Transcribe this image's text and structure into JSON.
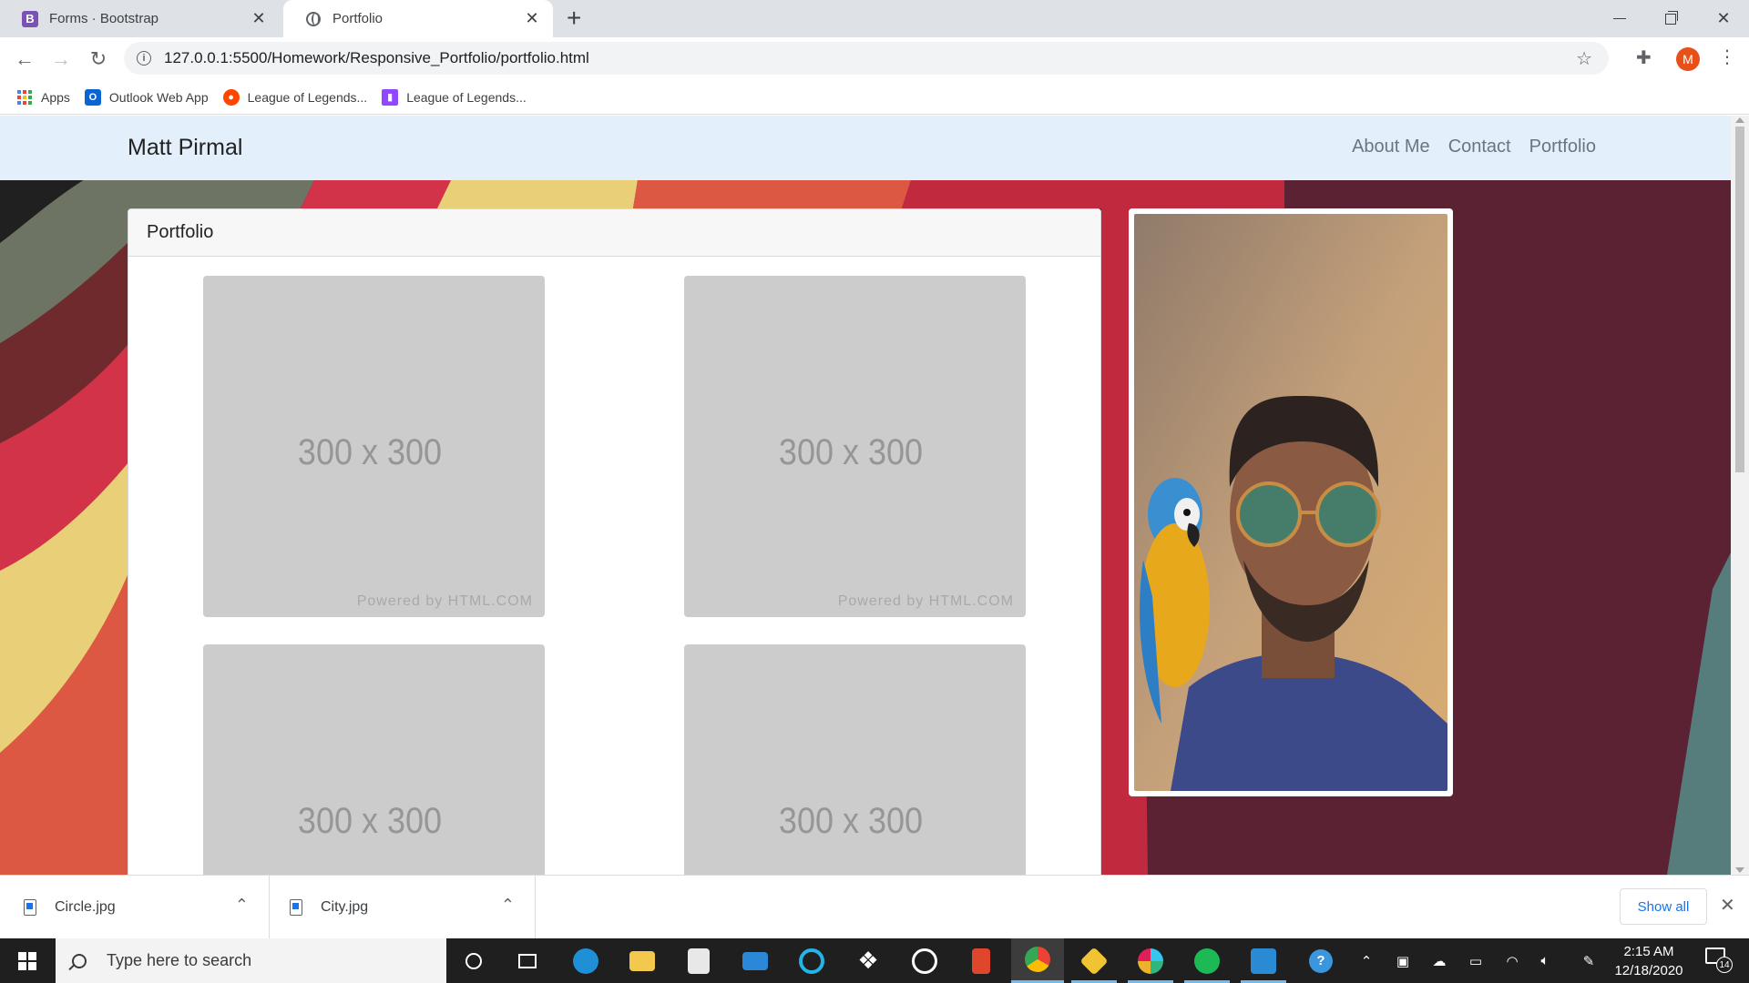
{
  "browser": {
    "tabs": [
      {
        "title": "Forms · Bootstrap",
        "favicon": "bootstrap-icon",
        "active": false
      },
      {
        "title": "Portfolio",
        "favicon": "globe-icon",
        "active": true
      }
    ],
    "url": "127.0.0.1:5500/Homework/Responsive_Portfolio/portfolio.html",
    "profile_initial": "M",
    "bookmarks": [
      {
        "label": "Apps",
        "icon": "apps-grid-icon"
      },
      {
        "label": "Outlook Web App",
        "icon": "outlook-icon"
      },
      {
        "label": "League of Legends...",
        "icon": "reddit-icon"
      },
      {
        "label": "League of Legends...",
        "icon": "twitch-icon"
      }
    ]
  },
  "site": {
    "brand": "Matt Pirmal",
    "nav": [
      "About Me",
      "Contact",
      "Portfolio"
    ],
    "card_title": "Portfolio",
    "placeholders": [
      {
        "label": "300 x 300",
        "credit": "Powered by HTML.COM"
      },
      {
        "label": "300 x 300",
        "credit": "Powered by HTML.COM"
      },
      {
        "label": "300 x 300",
        "credit": ""
      },
      {
        "label": "300 x 300",
        "credit": ""
      }
    ],
    "colors": {
      "nav_bg": "#e3f0fb",
      "page_bg": "#5a2233",
      "placeholder": "#cccccc"
    }
  },
  "downloads": {
    "items": [
      "Circle.jpg",
      "City.jpg"
    ],
    "show_all": "Show all"
  },
  "taskbar": {
    "search_placeholder": "Type here to search",
    "time": "2:15 AM",
    "date": "12/18/2020",
    "notifications": "14"
  }
}
